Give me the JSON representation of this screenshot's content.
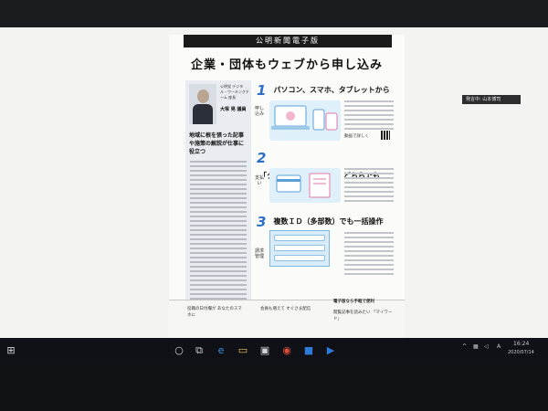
{
  "document": {
    "banner": "公明新聞電子版",
    "headline": "企業・団体もウェブから申し込み",
    "left_column": {
      "role": "公明党 デジタル・ワーキングチーム 座長",
      "name": "大塚 晃 議員",
      "heading": "地域に根を張った記事や施策の解説が仕事に役立つ"
    },
    "sections": [
      {
        "number": "1",
        "title": "パソコン、スマホ、タブレットから",
        "label": "申し込み",
        "caption": "動画で詳しく"
      },
      {
        "number": "2",
        "title": "「クレジット」「請求書」どちらでも",
        "label": "支払い"
      },
      {
        "number": "3",
        "title": "複数ＩＤ（多部数）でも一括操作",
        "label": "請求管理"
      }
    ],
    "bottom": {
      "left_title": "役職の日付欄が あなたのスマホに",
      "center_title": "会員も増えて すぐさま配信",
      "right_banner": "電子版なら手軽で便利",
      "right_title": "閲覧記事を読みたい 「マイワード」"
    }
  },
  "side_badge": "発言中: 山本博司",
  "taskbar": {
    "start_icon": "windows-logo-icon",
    "items": [
      "circle-search-icon",
      "task-view-icon",
      "edge-icon",
      "file-explorer-icon",
      "store-icon",
      "chrome-icon",
      "outlook-icon",
      "video-icon"
    ],
    "tray_ime": "A",
    "tray_time": "16:24",
    "tray_date": "2020/07/14"
  }
}
